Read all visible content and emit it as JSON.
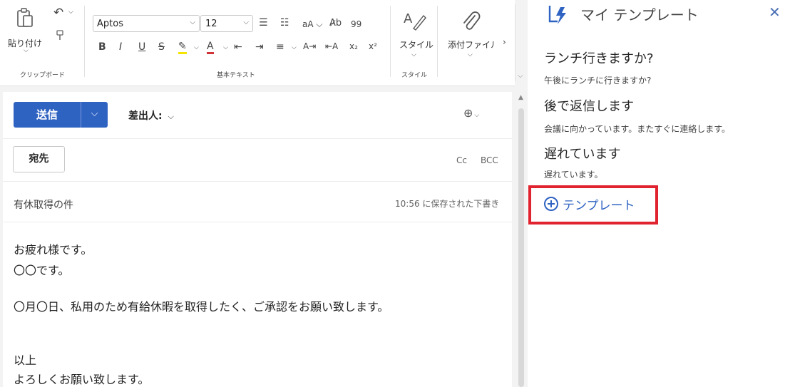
{
  "ribbon": {
    "clipboard": {
      "paste_label": "貼り付け",
      "group_label": "クリップボード"
    },
    "basic_text": {
      "font_name": "Aptos",
      "font_size": "12",
      "group_label": "基本テキスト",
      "spell_label": "99"
    },
    "styles": {
      "label": "スタイル",
      "group_label": "スタイル"
    },
    "attach": {
      "label": "添付ファイル"
    }
  },
  "compose": {
    "send_label": "送信",
    "from_label": "差出人:",
    "to_label": "宛先",
    "cc_label": "Cc",
    "bcc_label": "BCC",
    "subject": "有休取得の件",
    "draft_saved": "10:56 に保存された下書き",
    "body": [
      "お疲れ様です。",
      "〇〇です。",
      "〇月〇日、私用のため有給休暇を取得したく、ご承認をお願い致します。",
      "以上",
      "よろしくお願い致します。"
    ]
  },
  "templates_pane": {
    "title": "マイ テンプレート",
    "items": [
      {
        "title": "ランチ行きますか?",
        "body": "午後にランチに行きますか?"
      },
      {
        "title": "後で返信します",
        "body": "会議に向かっています。またすぐに連絡します。"
      },
      {
        "title": "遅れています",
        "body": "遅れています。"
      }
    ],
    "add_label": "テンプレート"
  },
  "colors": {
    "accent": "#2f63c2",
    "highlight": "#e0232e"
  }
}
